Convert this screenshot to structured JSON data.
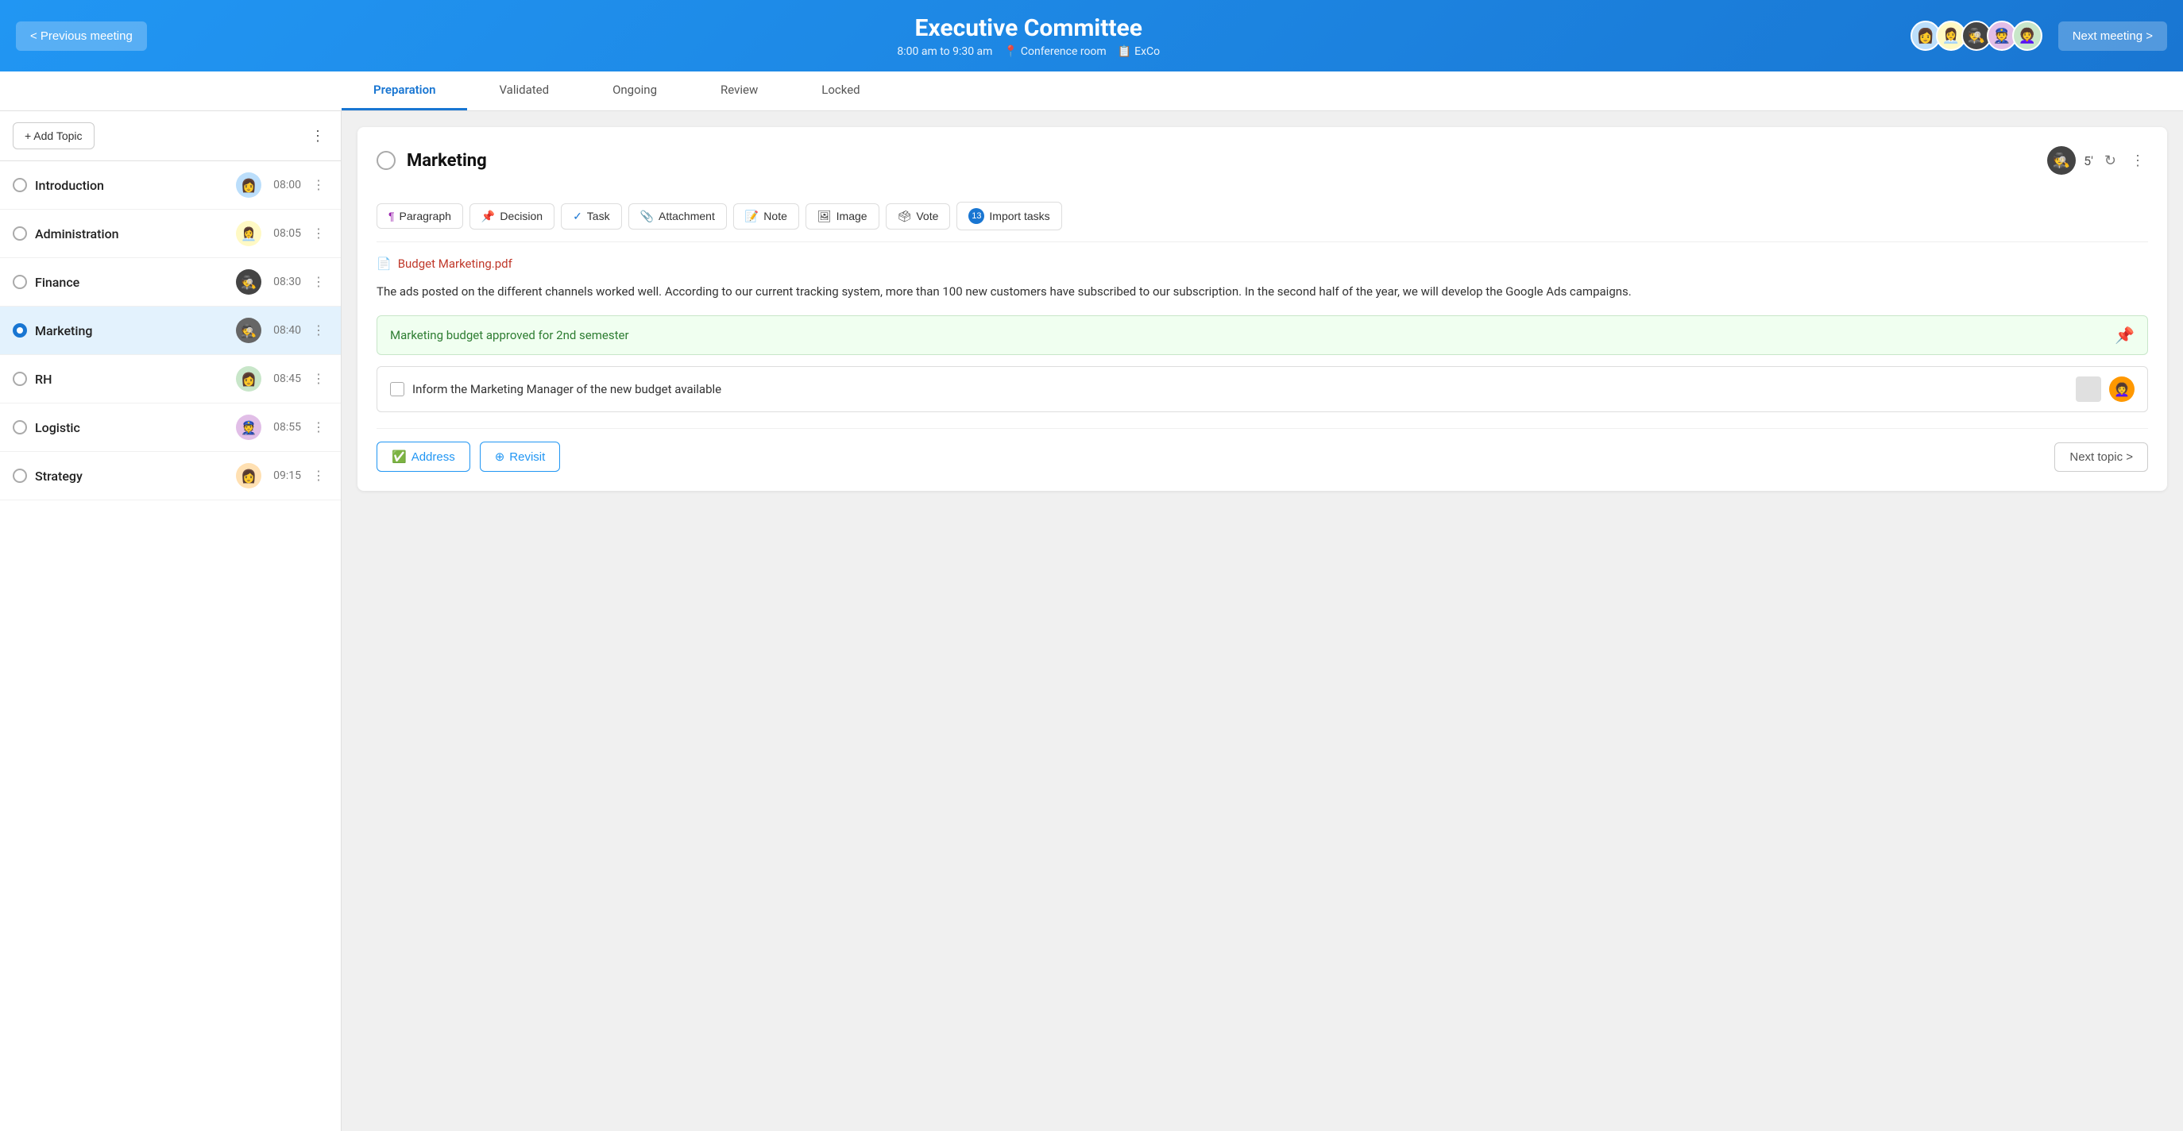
{
  "header": {
    "prev_button": "< Previous meeting",
    "title": "Executive Committee",
    "subtitle_time": "8:00 am to 9:30 am",
    "subtitle_location": "Conference room",
    "subtitle_code": "ExCo",
    "next_button": "Next meeting >"
  },
  "tabs": [
    {
      "id": "preparation",
      "label": "Preparation",
      "active": true
    },
    {
      "id": "validated",
      "label": "Validated",
      "active": false
    },
    {
      "id": "ongoing",
      "label": "Ongoing",
      "active": false
    },
    {
      "id": "review",
      "label": "Review",
      "active": false
    },
    {
      "id": "locked",
      "label": "Locked",
      "active": false
    }
  ],
  "sidebar": {
    "add_topic_label": "+ Add Topic",
    "topics": [
      {
        "id": "introduction",
        "name": "Introduction",
        "time": "08:00",
        "avatar": "👩",
        "avatar_bg": "#bbdefb",
        "active": false
      },
      {
        "id": "administration",
        "name": "Administration",
        "time": "08:05",
        "avatar": "👩‍💼",
        "avatar_bg": "#fff9c4",
        "active": false
      },
      {
        "id": "finance",
        "name": "Finance",
        "time": "08:30",
        "avatar": "🕵️",
        "avatar_bg": "#333",
        "active": false
      },
      {
        "id": "marketing",
        "name": "Marketing",
        "time": "08:40",
        "avatar": "🕵️",
        "avatar_bg": "#555",
        "active": true
      },
      {
        "id": "rh",
        "name": "RH",
        "time": "08:45",
        "avatar": "👩",
        "avatar_bg": "#c8e6c9",
        "active": false
      },
      {
        "id": "logistic",
        "name": "Logistic",
        "time": "08:55",
        "avatar": "👮",
        "avatar_bg": "#e1bee7",
        "active": false
      },
      {
        "id": "strategy",
        "name": "Strategy",
        "time": "09:15",
        "avatar": "👩",
        "avatar_bg": "#ffe0b2",
        "active": false
      }
    ]
  },
  "topic_card": {
    "title": "Marketing",
    "timer": "5'",
    "toolbar_buttons": [
      {
        "id": "paragraph",
        "icon": "¶",
        "label": "Paragraph",
        "icon_color": "#9c27b0"
      },
      {
        "id": "decision",
        "icon": "📌",
        "label": "Decision",
        "icon_color": "#4caf50"
      },
      {
        "id": "task",
        "icon": "✓",
        "label": "Task",
        "icon_color": "#1976d2"
      },
      {
        "id": "attachment",
        "icon": "📎",
        "label": "Attachment",
        "icon_color": "#e53935"
      },
      {
        "id": "note",
        "icon": "📝",
        "label": "Note",
        "icon_color": "#fbc02d"
      },
      {
        "id": "image",
        "icon": "🖼",
        "label": "Image",
        "icon_color": "#333"
      },
      {
        "id": "vote",
        "icon": "🗳",
        "label": "Vote",
        "icon_color": "#555"
      },
      {
        "id": "import_tasks",
        "icon": "13",
        "label": "Import tasks",
        "icon_color": "#1976d2"
      }
    ],
    "attachment_filename": "Budget Marketing.pdf",
    "body_text": "The ads posted on the different channels worked well. According to our current tracking system, more than 100 new customers have subscribed to our subscription. In the second half of the year, we will develop the Google Ads campaigns.",
    "decision_text": "Marketing budget approved for 2nd semester",
    "task_text": "Inform the Marketing Manager of the new budget available",
    "address_btn": "Address",
    "revisit_btn": "Revisit",
    "next_topic_btn": "Next topic >"
  },
  "avatars_header": [
    "👩",
    "👩‍💼",
    "🕵️",
    "👮",
    "👩‍🦱"
  ]
}
